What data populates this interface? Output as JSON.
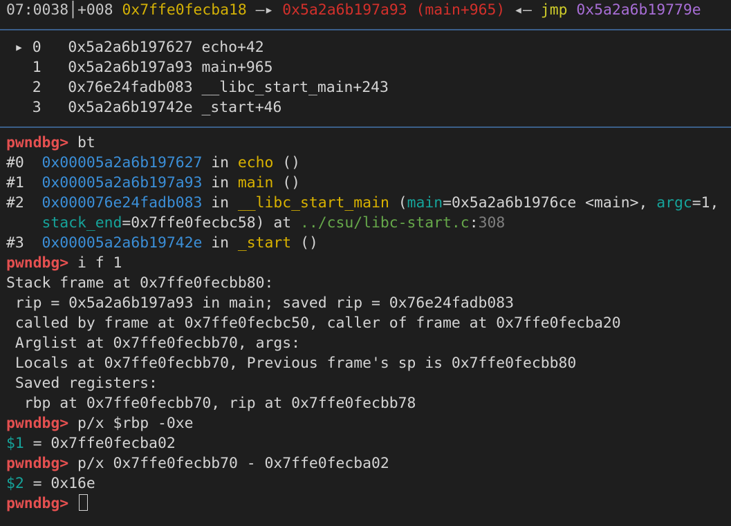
{
  "stack_line": {
    "index": "07:0038",
    "offset": "+008",
    "addr": "0x7ffe0fecba18",
    "arrow": "—▸",
    "target": "0x5a2a6b197a93 (main+965)",
    "back_arrow": "◂—",
    "instr": "jmp",
    "jmp_target": "0x5a2a6b19779e"
  },
  "backtrace_panel": [
    {
      "marker": "▸",
      "num": "0",
      "addr": "0x5a2a6b197627",
      "sym": "echo+42"
    },
    {
      "marker": "",
      "num": "1",
      "addr": "0x5a2a6b197a93",
      "sym": "main+965"
    },
    {
      "marker": "",
      "num": "2",
      "addr": "0x76e24fadb083",
      "sym": "__libc_start_main+243"
    },
    {
      "marker": "",
      "num": "3",
      "addr": "0x5a2a6b19742e",
      "sym": "_start+46"
    }
  ],
  "prompt": "pwndbg>",
  "commands": {
    "bt": "bt",
    "info_frame": "i f 1",
    "print1": "p/x $rbp -0xe",
    "print2": "p/x 0x7ffe0fecbb70 - 0x7ffe0fecba02"
  },
  "bt_output": {
    "f0": {
      "num": "#0",
      "addr": "0x00005a2a6b197627",
      "in": "in",
      "func": "echo",
      "args": "()"
    },
    "f1": {
      "num": "#1",
      "addr": "0x00005a2a6b197a93",
      "in": "in",
      "func": "main",
      "args": "()"
    },
    "f2": {
      "num": "#2",
      "addr": "0x000076e24fadb083",
      "in": "in",
      "func": "__libc_start_main",
      "open": "(",
      "p1_name": "main",
      "p1_val": "=0x5a2a6b1976ce <main>, ",
      "p2_name": "argc",
      "p2_val": "=1,",
      "p3_name": "stack_end",
      "p3_val": "=0x7ffe0fecbc58) at ",
      "file": "../csu/libc-start.c",
      "colon": ":",
      "line": "308"
    },
    "f3": {
      "num": "#3",
      "addr": "0x00005a2a6b19742e",
      "in": "in",
      "func": "_start",
      "args": "()"
    }
  },
  "frame_info": [
    "Stack frame at 0x7ffe0fecbb80:",
    " rip = 0x5a2a6b197a93 in main; saved rip = 0x76e24fadb083",
    " called by frame at 0x7ffe0fecbc50, caller of frame at 0x7ffe0fecba20",
    " Arglist at 0x7ffe0fecbb70, args:",
    " Locals at 0x7ffe0fecbb70, Previous frame's sp is 0x7ffe0fecbb80",
    " Saved registers:",
    "  rbp at 0x7ffe0fecbb70, rip at 0x7ffe0fecbb78"
  ],
  "results": {
    "r1_var": "$1",
    "r1_val": " = 0x7ffe0fecba02",
    "r2_var": "$2",
    "r2_val": " = 0x16e"
  },
  "colors": {
    "background": "#1e1e1e",
    "prompt": "#e55050",
    "address_blue": "#3b8fd8",
    "function_yellow": "#d9b200",
    "teal": "#16a39a",
    "rule": "#3b5f8a"
  }
}
